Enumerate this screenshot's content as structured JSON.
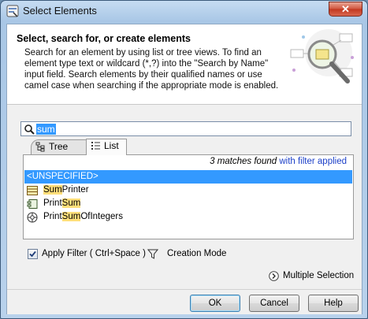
{
  "window": {
    "title": "Select Elements",
    "close_label": "✕",
    "app_icon": "app-icon"
  },
  "header": {
    "title": "Select, search for, or create elements",
    "description": "Search for an element by using list or tree views. To find an element type text or wildcard (*,?) into the \"Search by Name\" input field. Search elements by their qualified names or use camel case when searching if the appropriate mode is enabled.",
    "illustration": "magnifier-diagram-icon"
  },
  "search": {
    "value": "sum",
    "icon": "search-icon"
  },
  "tabs": [
    {
      "label": "Tree",
      "icon": "tree-icon",
      "active": false
    },
    {
      "label": "List",
      "icon": "list-icon",
      "active": true
    }
  ],
  "results": {
    "count_text": "3 matches found",
    "filter_text": " with filter applied",
    "items": [
      {
        "pre": "<UNSPECIFIED>",
        "match": "",
        "post": "",
        "icon": "",
        "selected": true
      },
      {
        "pre": "",
        "match": "Sum",
        "post": "Printer",
        "icon": "class-icon",
        "selected": false
      },
      {
        "pre": "Print",
        "match": "Sum",
        "post": "",
        "icon": "component-icon",
        "selected": false
      },
      {
        "pre": "Print",
        "match": "Sum",
        "post": "OfIntegers",
        "icon": "package-icon",
        "selected": false
      }
    ]
  },
  "options": {
    "apply_filter_label": "Apply Filter ( Ctrl+Space )",
    "apply_filter_checked": true,
    "funnel_icon": "funnel-icon",
    "creation_mode_label": "Creation Mode",
    "multiple_selection_label": "Multiple Selection",
    "multiple_selection_icon": "chevron-right-circle-icon"
  },
  "buttons": {
    "ok": "OK",
    "cancel": "Cancel",
    "help": "Help"
  },
  "colors": {
    "selection": "#3399ff",
    "match_highlight": "#ffdf7a",
    "filter_link": "#1b3fc8"
  }
}
